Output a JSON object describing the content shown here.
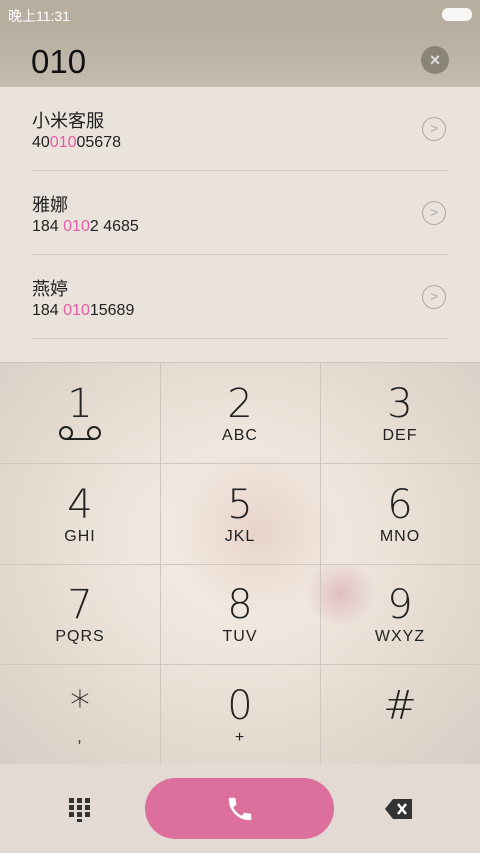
{
  "status": {
    "time": "晚上11:31"
  },
  "dialer": {
    "number": "010",
    "clear_icon": "×"
  },
  "results": [
    {
      "name": "小米客服",
      "phone_pre": "40",
      "phone_hl": "010",
      "phone_post": "05678"
    },
    {
      "name": "雅娜",
      "phone_pre": "184 ",
      "phone_hl": "010",
      "phone_post": "2 4685"
    },
    {
      "name": "燕婷",
      "phone_pre": "184 ",
      "phone_hl": "010",
      "phone_post": "15689"
    }
  ],
  "keys": [
    {
      "digit": "1",
      "letters": ""
    },
    {
      "digit": "2",
      "letters": "ABC"
    },
    {
      "digit": "3",
      "letters": "DEF"
    },
    {
      "digit": "4",
      "letters": "GHI"
    },
    {
      "digit": "5",
      "letters": "JKL"
    },
    {
      "digit": "6",
      "letters": "MNO"
    },
    {
      "digit": "7",
      "letters": "PQRS"
    },
    {
      "digit": "8",
      "letters": "TUV"
    },
    {
      "digit": "9",
      "letters": "WXYZ"
    },
    {
      "digit": "*",
      "letters": ","
    },
    {
      "digit": "0",
      "letters": "+"
    },
    {
      "digit": "#",
      "letters": ""
    }
  ],
  "colors": {
    "accent": "#e85aa6",
    "call_button": "#dd6f9d"
  }
}
